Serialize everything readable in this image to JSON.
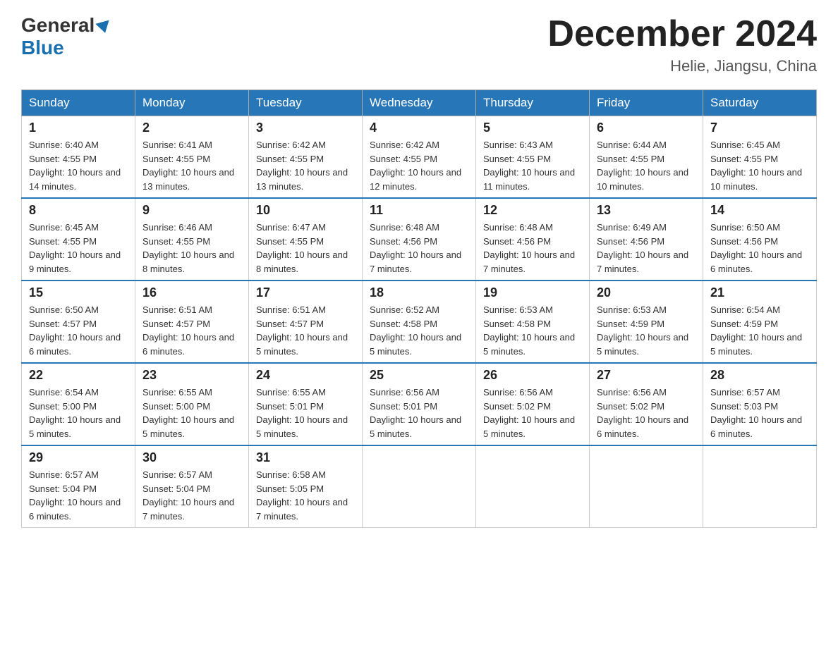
{
  "header": {
    "logo_general": "General",
    "logo_blue": "Blue",
    "month_title": "December 2024",
    "location": "Helie, Jiangsu, China"
  },
  "days_of_week": [
    "Sunday",
    "Monday",
    "Tuesday",
    "Wednesday",
    "Thursday",
    "Friday",
    "Saturday"
  ],
  "weeks": [
    [
      {
        "day": "1",
        "sunrise": "6:40 AM",
        "sunset": "4:55 PM",
        "daylight": "10 hours and 14 minutes."
      },
      {
        "day": "2",
        "sunrise": "6:41 AM",
        "sunset": "4:55 PM",
        "daylight": "10 hours and 13 minutes."
      },
      {
        "day": "3",
        "sunrise": "6:42 AM",
        "sunset": "4:55 PM",
        "daylight": "10 hours and 13 minutes."
      },
      {
        "day": "4",
        "sunrise": "6:42 AM",
        "sunset": "4:55 PM",
        "daylight": "10 hours and 12 minutes."
      },
      {
        "day": "5",
        "sunrise": "6:43 AM",
        "sunset": "4:55 PM",
        "daylight": "10 hours and 11 minutes."
      },
      {
        "day": "6",
        "sunrise": "6:44 AM",
        "sunset": "4:55 PM",
        "daylight": "10 hours and 10 minutes."
      },
      {
        "day": "7",
        "sunrise": "6:45 AM",
        "sunset": "4:55 PM",
        "daylight": "10 hours and 10 minutes."
      }
    ],
    [
      {
        "day": "8",
        "sunrise": "6:45 AM",
        "sunset": "4:55 PM",
        "daylight": "10 hours and 9 minutes."
      },
      {
        "day": "9",
        "sunrise": "6:46 AM",
        "sunset": "4:55 PM",
        "daylight": "10 hours and 8 minutes."
      },
      {
        "day": "10",
        "sunrise": "6:47 AM",
        "sunset": "4:55 PM",
        "daylight": "10 hours and 8 minutes."
      },
      {
        "day": "11",
        "sunrise": "6:48 AM",
        "sunset": "4:56 PM",
        "daylight": "10 hours and 7 minutes."
      },
      {
        "day": "12",
        "sunrise": "6:48 AM",
        "sunset": "4:56 PM",
        "daylight": "10 hours and 7 minutes."
      },
      {
        "day": "13",
        "sunrise": "6:49 AM",
        "sunset": "4:56 PM",
        "daylight": "10 hours and 7 minutes."
      },
      {
        "day": "14",
        "sunrise": "6:50 AM",
        "sunset": "4:56 PM",
        "daylight": "10 hours and 6 minutes."
      }
    ],
    [
      {
        "day": "15",
        "sunrise": "6:50 AM",
        "sunset": "4:57 PM",
        "daylight": "10 hours and 6 minutes."
      },
      {
        "day": "16",
        "sunrise": "6:51 AM",
        "sunset": "4:57 PM",
        "daylight": "10 hours and 6 minutes."
      },
      {
        "day": "17",
        "sunrise": "6:51 AM",
        "sunset": "4:57 PM",
        "daylight": "10 hours and 5 minutes."
      },
      {
        "day": "18",
        "sunrise": "6:52 AM",
        "sunset": "4:58 PM",
        "daylight": "10 hours and 5 minutes."
      },
      {
        "day": "19",
        "sunrise": "6:53 AM",
        "sunset": "4:58 PM",
        "daylight": "10 hours and 5 minutes."
      },
      {
        "day": "20",
        "sunrise": "6:53 AM",
        "sunset": "4:59 PM",
        "daylight": "10 hours and 5 minutes."
      },
      {
        "day": "21",
        "sunrise": "6:54 AM",
        "sunset": "4:59 PM",
        "daylight": "10 hours and 5 minutes."
      }
    ],
    [
      {
        "day": "22",
        "sunrise": "6:54 AM",
        "sunset": "5:00 PM",
        "daylight": "10 hours and 5 minutes."
      },
      {
        "day": "23",
        "sunrise": "6:55 AM",
        "sunset": "5:00 PM",
        "daylight": "10 hours and 5 minutes."
      },
      {
        "day": "24",
        "sunrise": "6:55 AM",
        "sunset": "5:01 PM",
        "daylight": "10 hours and 5 minutes."
      },
      {
        "day": "25",
        "sunrise": "6:56 AM",
        "sunset": "5:01 PM",
        "daylight": "10 hours and 5 minutes."
      },
      {
        "day": "26",
        "sunrise": "6:56 AM",
        "sunset": "5:02 PM",
        "daylight": "10 hours and 5 minutes."
      },
      {
        "day": "27",
        "sunrise": "6:56 AM",
        "sunset": "5:02 PM",
        "daylight": "10 hours and 6 minutes."
      },
      {
        "day": "28",
        "sunrise": "6:57 AM",
        "sunset": "5:03 PM",
        "daylight": "10 hours and 6 minutes."
      }
    ],
    [
      {
        "day": "29",
        "sunrise": "6:57 AM",
        "sunset": "5:04 PM",
        "daylight": "10 hours and 6 minutes."
      },
      {
        "day": "30",
        "sunrise": "6:57 AM",
        "sunset": "5:04 PM",
        "daylight": "10 hours and 7 minutes."
      },
      {
        "day": "31",
        "sunrise": "6:58 AM",
        "sunset": "5:05 PM",
        "daylight": "10 hours and 7 minutes."
      },
      null,
      null,
      null,
      null
    ]
  ]
}
